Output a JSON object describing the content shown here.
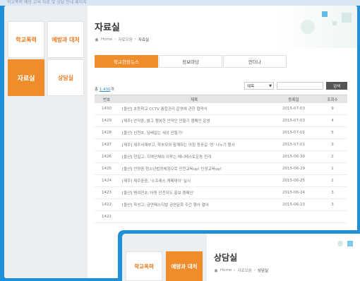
{
  "top_strip": {
    "text": "학교폭력 예방 교육 자료 및 상담 안내 페이지"
  },
  "sidebar": {
    "tiles": [
      {
        "label": "학교폭력",
        "style": "white"
      },
      {
        "label": "예방과 대처",
        "style": "white"
      },
      {
        "label": "자료실",
        "style": "orange"
      },
      {
        "label": "상담실",
        "style": "white"
      }
    ]
  },
  "page": {
    "title": "자료실",
    "breadcrumb": [
      "Home",
      "자료모음",
      "자료실"
    ]
  },
  "tabs": [
    {
      "label": "학교현장뉴스",
      "active": true
    },
    {
      "label": "정보마당",
      "active": false
    },
    {
      "label": "언더나",
      "active": false
    }
  ],
  "summary": {
    "prefix": "총",
    "count": "1,430",
    "suffix": "개"
  },
  "search": {
    "select_value": "제목",
    "button_label": "검색"
  },
  "table": {
    "headers": [
      "번호",
      "제목",
      "등록일",
      "조회수"
    ],
    "rows": [
      {
        "no": "1430",
        "title": "[울산] 초등학교 CCTV 통합관리 운영에 관한 협약식",
        "date": "2015-07-03",
        "views": "9"
      },
      {
        "no": "1429",
        "title": "[제주] 안덕중, 밝고 행복한 안덕인 만들기 캠페인 운영",
        "date": "2015-07-03",
        "views": "4"
      },
      {
        "no": "1428",
        "title": "[울산] 신천초, 담배없는 세상 만들기!",
        "date": "2015-07-01",
        "views": "5"
      },
      {
        "no": "1427",
        "title": "[제주] 제주서재부고, 학부모와 함께하는 아침 등굣길 '정' 나누기 행사",
        "date": "2015-07-01",
        "views": "3"
      },
      {
        "no": "1426",
        "title": "[울산] 현일고, 지역단체와 이루는 매니페스토운동 전개",
        "date": "2015-06-30",
        "views": "2"
      },
      {
        "no": "1425",
        "title": "[울산] 언양중 청소년법정체험으로 안전교육up! 인성교육up!",
        "date": "2015-06-29",
        "views": "1"
      },
      {
        "no": "1424",
        "title": "[제주] 제주중중, '소프레스 캐페테이' 실시",
        "date": "2015-06-25",
        "views": "2"
      },
      {
        "no": "1423",
        "title": "[울산] 병여전초,'아동 안전지도 홍보 캠페인'",
        "date": "2015-06-24",
        "views": "3"
      },
      {
        "no": "1422",
        "title": "[울산] 학성고, 금연페스티벌 금연문화 주간 행사 열어",
        "date": "2015-06-23",
        "views": "3"
      },
      {
        "no": "1421",
        "title": "",
        "date": "",
        "views": ""
      }
    ]
  },
  "overlay": {
    "tiles": [
      "학교폭력",
      "예방과 대처"
    ],
    "title": "상담실",
    "breadcrumb": [
      "Home",
      "자료모음",
      "상담실"
    ]
  }
}
